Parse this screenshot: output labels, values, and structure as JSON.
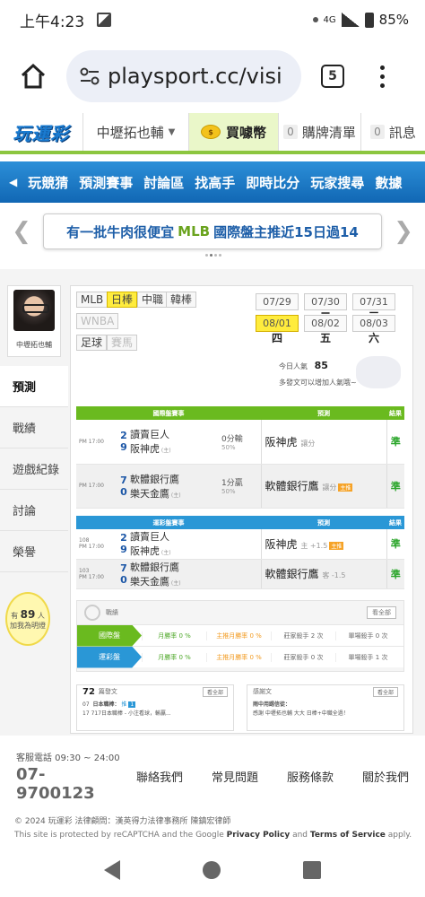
{
  "status_bar": {
    "time": "上午4:23",
    "network": "4G",
    "battery": "85%"
  },
  "browser": {
    "url": "playsport.cc/visi",
    "tab_count": "5"
  },
  "top_nav": {
    "logo": "玩運彩",
    "user": "中壢拓也輔",
    "coin_label": "買噱幣",
    "cart_count": "0",
    "cart_label": "購牌清單",
    "msg_count": "0",
    "msg_label": "訊息"
  },
  "main_nav": {
    "items": [
      "玩競猜",
      "預測賽事",
      "討論區",
      "找高手",
      "即時比分",
      "玩家搜尋",
      "數據"
    ]
  },
  "banner": {
    "text_before": "有一批牛肉很便宜 ",
    "highlight": "MLB",
    "text_after": " 國際盤主推近15日過14"
  },
  "profile": {
    "name": "中壢拓也輔"
  },
  "side_menu": [
    "預測",
    "戰績",
    "遊戲紀錄",
    "討論",
    "榮譽"
  ],
  "bulb": {
    "pre": "有",
    "count": "89",
    "unit": "人",
    "text": "加我為明燈"
  },
  "leagues": {
    "row1": [
      "MLB",
      "日棒",
      "中職",
      "韓棒"
    ],
    "row2": [
      "WNBA"
    ],
    "row3": [
      "足球",
      "賽馬"
    ],
    "selected": "日棒"
  },
  "dates": [
    {
      "date": "07/29",
      "dow": "一"
    },
    {
      "date": "07/30",
      "dow": "二"
    },
    {
      "date": "07/31",
      "dow": "三"
    },
    {
      "date": "08/01",
      "dow": "四"
    },
    {
      "date": "08/02",
      "dow": "五"
    },
    {
      "date": "08/03",
      "dow": "六"
    }
  ],
  "popularity": {
    "label": "今日人氣",
    "value": "85",
    "note": "多發文可以增加人氣哦~"
  },
  "intl_table": {
    "headers": [
      "國際盤賽事",
      "預測",
      "結果"
    ],
    "rows": [
      {
        "time": "PM 17:00",
        "score1": "2",
        "team1": "讀賣巨人",
        "score2": "9",
        "team2": "阪神虎",
        "handicap": "0分輸",
        "pct": "50%",
        "pick": "阪神虎",
        "pick_note": "讓分",
        "result": "準"
      },
      {
        "time": "PM 17:00",
        "score1": "7",
        "team1": "軟體銀行鷹",
        "score2": "0",
        "team2": "樂天金鷹",
        "handicap": "1分贏",
        "pct": "50%",
        "pick": "軟體銀行鷹",
        "pick_note": "讓分",
        "result": "準"
      }
    ]
  },
  "lottery_table": {
    "headers": [
      "運彩盤賽事",
      "預測",
      "結果"
    ],
    "rows": [
      {
        "num": "108",
        "time": "PM 17:00",
        "score1": "2",
        "team1": "讀賣巨人",
        "score2": "9",
        "team2": "阪神虎",
        "pick": "阪神虎",
        "pick_note": "主 +1.5",
        "result": "準"
      },
      {
        "num": "103",
        "time": "PM 17:00",
        "score1": "7",
        "team1": "軟體銀行鷹",
        "score2": "0",
        "team2": "樂天金鷹",
        "pick": "軟體銀行鷹",
        "pick_note": "客 -1.5",
        "result": "準"
      }
    ]
  },
  "record": {
    "title": "戰績",
    "all": "看全部",
    "rows": [
      {
        "label": "國際盤",
        "win": "月勝率 0 %",
        "main": "主推月勝率 0 %",
        "season": "莊家殺手 2 次",
        "single": "單場殺手 0 次"
      },
      {
        "label": "運彩盤",
        "win": "月勝率 0 %",
        "main": "主推月勝率 0 %",
        "season": "莊家殺手 0 次",
        "single": "單場殺手 1 次"
      }
    ]
  },
  "posts": {
    "count": "72",
    "label": "篇發文",
    "all": "看全部",
    "date_m": "07",
    "date_d": "17",
    "title": "日本職棒：",
    "desc": "717日本職棒 - 小注看球，輸贏...",
    "push_label": "推",
    "push_count": "1"
  },
  "thanks": {
    "label": "感謝文",
    "all": "看全部",
    "title": "雨中用踢信徒：",
    "desc": "感謝 中壢拓也輔 大大 日棒+中職全過！"
  },
  "footer": {
    "service_label": "客服電話 09:30 ~ 24:00",
    "phone": "07-9700123",
    "links": [
      "聯絡我們",
      "常見問題",
      "服務條款",
      "關於我們"
    ],
    "copyright": "© 2024 玩運彩 法律顧問：漢英得力法律事務所 陳鎮宏律師",
    "captcha_pre": "This site is protected by reCAPTCHA and the Google ",
    "captcha_pp": "Privacy Policy",
    "captcha_and": " and ",
    "captcha_tos": "Terms of Service",
    "captcha_post": " apply."
  }
}
